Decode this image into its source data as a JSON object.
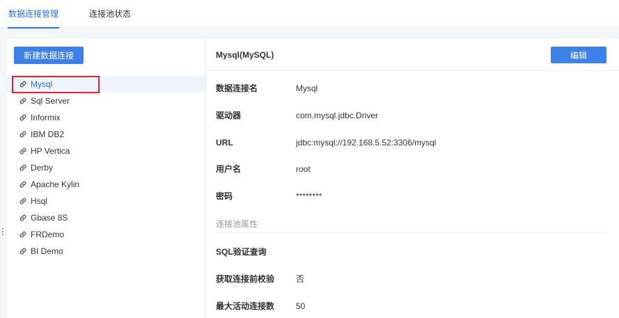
{
  "tabs": [
    {
      "label": "数据连接管理",
      "active": true
    },
    {
      "label": "连接池状态",
      "active": false
    }
  ],
  "new_button_label": "新建数据连接",
  "connections": [
    {
      "name": "Mysql",
      "selected": true
    },
    {
      "name": "Sql Server"
    },
    {
      "name": "Informix"
    },
    {
      "name": "IBM DB2"
    },
    {
      "name": "HP Vertica"
    },
    {
      "name": "Derby"
    },
    {
      "name": "Apache Kylin"
    },
    {
      "name": "Hsql"
    },
    {
      "name": "Gbase 8S"
    },
    {
      "name": "FRDemo"
    },
    {
      "name": "BI Demo"
    }
  ],
  "detail": {
    "title": "Mysql(MySQL)",
    "edit_label": "编辑",
    "fields": [
      {
        "label": "数据连接名",
        "value": "Mysql"
      },
      {
        "label": "驱动器",
        "value": "com.mysql.jdbc.Driver"
      },
      {
        "label": "URL",
        "value": "jdbc:mysql://192.168.5.52:3306/mysql"
      },
      {
        "label": "用户名",
        "value": "root"
      },
      {
        "label": "密码",
        "value": "********"
      }
    ],
    "pool_section_label": "连接池属性",
    "pool_fields": [
      {
        "label": "SQL验证查询",
        "value": ""
      },
      {
        "label": "获取连接前校验",
        "value": "否"
      },
      {
        "label": "最大活动连接数",
        "value": "50"
      }
    ]
  },
  "colors": {
    "accent": "#2f6fe0",
    "button": "#3d80e8",
    "highlight_box": "#e5202a",
    "selected_bg": "#eef3fd"
  },
  "icons": {
    "connection_item": "link-icon"
  }
}
